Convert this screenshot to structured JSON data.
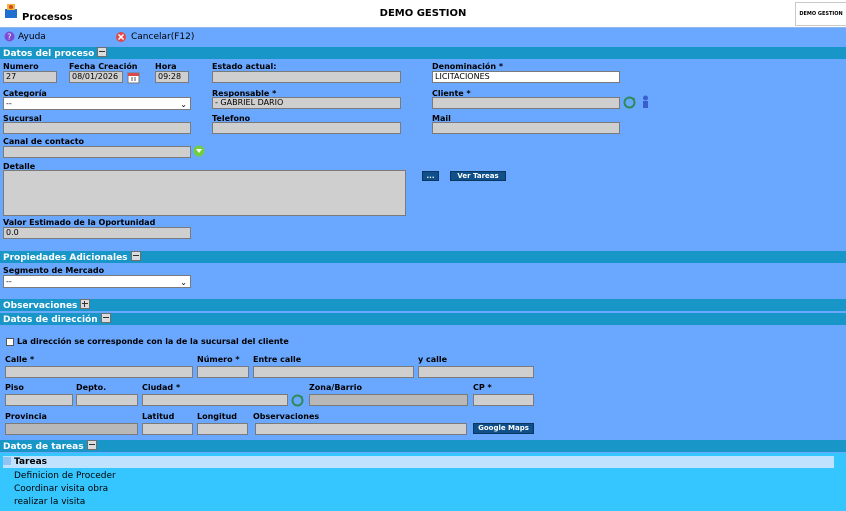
{
  "header": {
    "app_title": "Procesos",
    "center_title": "DEMO GESTION",
    "logo_text": "DEMO GESTION"
  },
  "toolbar": {
    "help_label": "Ayuda",
    "cancel_label": "Cancelar(F12)"
  },
  "sections": {
    "process_data": "Datos del proceso",
    "additional_props": "Propiedades Adicionales",
    "observations": "Observaciones",
    "address_data": "Datos de dirección",
    "tasks_data": "Datos de tareas"
  },
  "process": {
    "numero_label": "Numero",
    "numero_value": "27",
    "fecha_label": "Fecha Creación",
    "fecha_value": "08/01/2026",
    "hora_label": "Hora",
    "hora_value": "09:28",
    "estado_label": "Estado actual:",
    "estado_value": "",
    "denominacion_label": "Denominación *",
    "denominacion_value": "LICITACIONES",
    "categoria_label": "Categoría",
    "categoria_value": "--",
    "responsable_label": "Responsable *",
    "responsable_value": "- GABRIEL DARIO",
    "cliente_label": "Cliente *",
    "cliente_value": "",
    "sucursal_label": "Sucursal",
    "sucursal_value": "",
    "telefono_label": "Telefono",
    "telefono_value": "",
    "mail_label": "Mail",
    "mail_value": "",
    "canal_label": "Canal de contacto",
    "canal_value": "",
    "detalle_label": "Detalle",
    "detalle_value": "",
    "dots_button": "...",
    "ver_tareas_button": "Ver Tareas",
    "valor_label": "Valor Estimado de la Oportunidad",
    "valor_value": "0.0"
  },
  "additional": {
    "segmento_label": "Segmento de Mercado",
    "segmento_value": "--"
  },
  "address": {
    "checkbox_label": "La dirección se corresponde con la de la sucursal del cliente",
    "calle_label": "Calle *",
    "numero_label": "Número *",
    "entre_label": "Entre calle",
    "ycalle_label": "y calle",
    "piso_label": "Piso",
    "depto_label": "Depto.",
    "ciudad_label": "Ciudad *",
    "zona_label": "Zona/Barrio",
    "cp_label": "CP *",
    "provincia_label": "Provincia",
    "latitud_label": "Latitud",
    "longitud_label": "Longitud",
    "observaciones_label": "Observaciones",
    "maps_button": "Google Maps"
  },
  "tasks": {
    "header": "Tareas",
    "items": [
      "Definicion de Proceder",
      "Coordinar visita obra",
      "realizar la visita"
    ]
  },
  "colors": {
    "background": "#6aa7ff",
    "section_bar": "#1996c8",
    "button": "#0f4f8a"
  }
}
